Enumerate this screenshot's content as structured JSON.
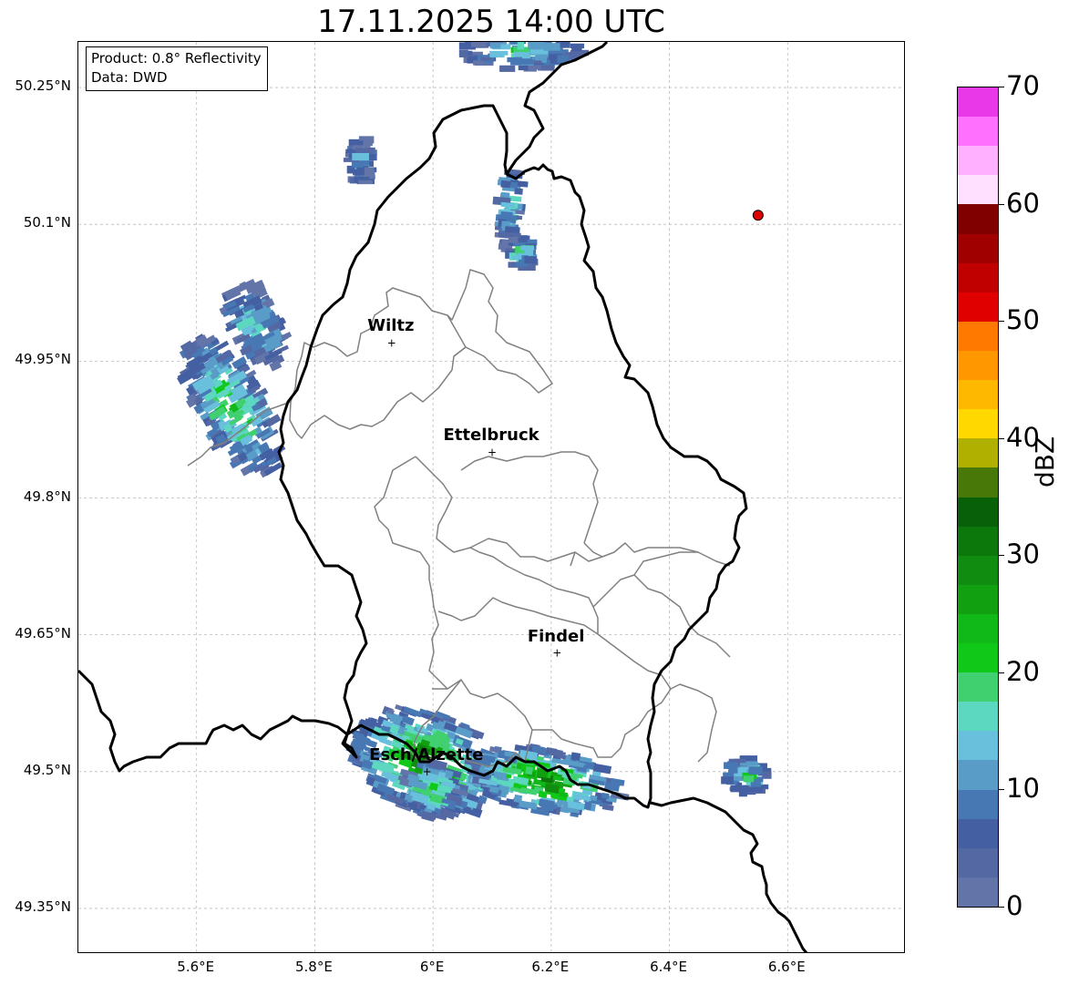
{
  "title": "17.11.2025 14:00 UTC",
  "info": {
    "product_line": "Product: 0.8° Reflectivity",
    "data_line": "Data: DWD"
  },
  "axes": {
    "lat_ticks": [
      "50.25°N",
      "50.1°N",
      "49.95°N",
      "49.8°N",
      "49.65°N",
      "49.5°N",
      "49.35°N"
    ],
    "lon_ticks": [
      "5.6°E",
      "5.8°E",
      "6°E",
      "6.2°E",
      "6.4°E",
      "6.6°E"
    ],
    "grid": true
  },
  "cities": [
    {
      "name": "Wiltz",
      "lat": 49.97,
      "lon": 5.93
    },
    {
      "name": "Ettelbruck",
      "lat": 49.85,
      "lon": 6.1
    },
    {
      "name": "Findel",
      "lat": 49.63,
      "lon": 6.21
    },
    {
      "name": "Esch/Alzette",
      "lat": 49.5,
      "lon": 5.99
    }
  ],
  "radar_site": {
    "lat": 50.11,
    "lon": 6.55,
    "color": "#e00000"
  },
  "colorbar": {
    "label": "dBZ",
    "ticks": [
      "0",
      "10",
      "20",
      "30",
      "40",
      "50",
      "60",
      "70"
    ],
    "min": 0,
    "max": 70,
    "colors": [
      "#6374a8",
      "#5468a4",
      "#4460a2",
      "#4878b4",
      "#5a9cc8",
      "#68c0dc",
      "#5cd8c0",
      "#40d070",
      "#10c818",
      "#10b818",
      "#10a010",
      "#108c10",
      "#0c780c",
      "#086008",
      "#487808",
      "#b0b000",
      "#ffd800",
      "#ffb800",
      "#ff9800",
      "#ff7800",
      "#e00000",
      "#c00000",
      "#a00000",
      "#800000",
      "#ffe0ff",
      "#ffb0ff",
      "#ff70ff",
      "#e838e8"
    ]
  },
  "echoes": [
    {
      "lat": 49.51,
      "lon": 5.99,
      "rlon": 0.13,
      "rlat": 0.055,
      "rot": 20,
      "max_dbz": 32
    },
    {
      "lat": 49.48,
      "lon": 6.0,
      "rlon": 0.05,
      "rlat": 0.03,
      "rot": 15,
      "max_dbz": 25
    },
    {
      "lat": 49.49,
      "lon": 6.19,
      "rlon": 0.13,
      "rlat": 0.035,
      "rot": 10,
      "max_dbz": 30
    },
    {
      "lat": 49.9,
      "lon": 5.66,
      "rlon": 0.055,
      "rlat": 0.085,
      "rot": -30,
      "max_dbz": 25
    },
    {
      "lat": 49.99,
      "lon": 5.7,
      "rlon": 0.04,
      "rlat": 0.05,
      "rot": -25,
      "max_dbz": 18
    },
    {
      "lat": 49.495,
      "lon": 6.53,
      "rlon": 0.035,
      "rlat": 0.02,
      "rot": 0,
      "max_dbz": 22
    },
    {
      "lat": 50.12,
      "lon": 6.13,
      "rlon": 0.015,
      "rlat": 0.05,
      "rot": 5,
      "max_dbz": 18
    },
    {
      "lat": 50.07,
      "lon": 6.15,
      "rlon": 0.02,
      "rlat": 0.02,
      "rot": 0,
      "max_dbz": 22
    },
    {
      "lat": 50.17,
      "lon": 5.88,
      "rlon": 0.02,
      "rlat": 0.025,
      "rot": 0,
      "max_dbz": 14
    },
    {
      "lat": 50.29,
      "lon": 6.15,
      "rlon": 0.1,
      "rlat": 0.02,
      "rot": 0,
      "max_dbz": 18
    }
  ],
  "borders": {
    "country_color": "#000000",
    "canton_color": "#808080"
  }
}
